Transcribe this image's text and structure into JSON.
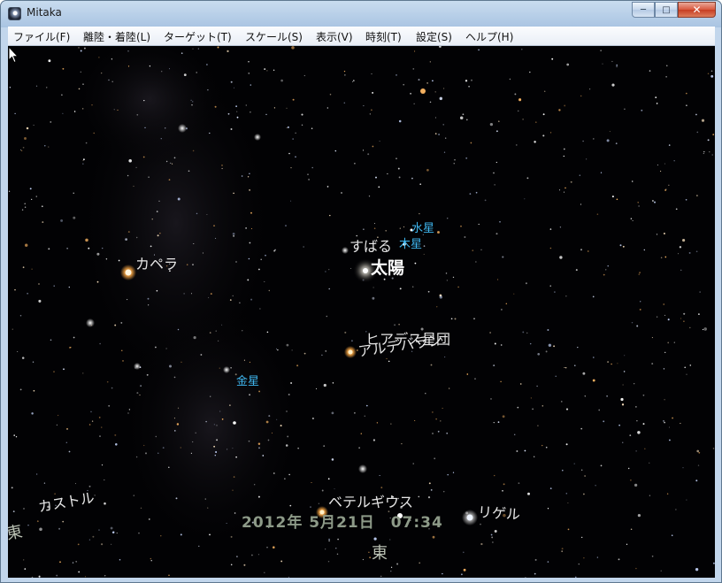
{
  "window": {
    "title": "Mitaka"
  },
  "caption_buttons": {
    "minimize": "─",
    "maximize": "□",
    "close": "✕"
  },
  "menu": [
    "ファイル(F)",
    "離陸・着陸(L)",
    "ターゲット(T)",
    "スケール(S)",
    "表示(V)",
    "時刻(T)",
    "設定(S)",
    "ヘルプ(H)"
  ],
  "sky": {
    "labels": {
      "mercury": "水星",
      "subaru": "すばる",
      "jupiter": "木星",
      "sun": "太陽",
      "capella": "カペラ",
      "hyades": "ヒアデス星団",
      "aldebaran": "アルデバラン",
      "venus": "金星",
      "castor": "カストル",
      "betelgeuse": "ベテルギウス",
      "rigel": "リゲル"
    },
    "date": "2012年  5月21日",
    "time": "07:34",
    "direction_south": "東",
    "direction_left": "東"
  },
  "colors": {
    "planet_label": "#3fb7f0",
    "date_text": "#8d9a88"
  }
}
